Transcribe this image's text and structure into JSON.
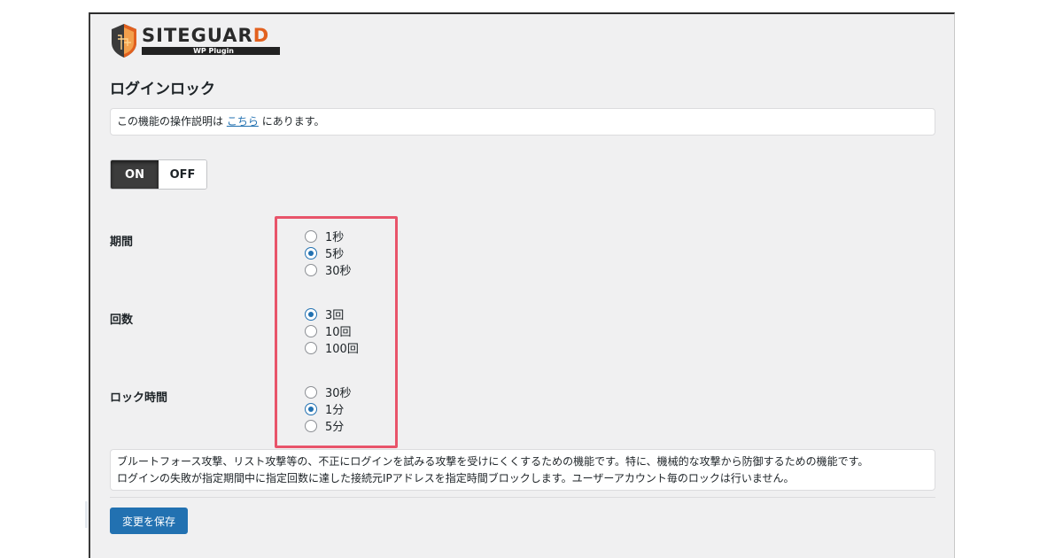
{
  "logo": {
    "wordmark_main": "SITEGUAR",
    "wordmark_accent": "D",
    "subtitle": "WP Plugin"
  },
  "page": {
    "title": "ログインロック",
    "notice_prefix": "この機能の操作説明は",
    "notice_link": "こちら",
    "notice_suffix": "にあります。"
  },
  "toggle": {
    "on_label": "ON",
    "off_label": "OFF",
    "selected": "ON"
  },
  "fields": {
    "period": {
      "label": "期間",
      "options": [
        "1秒",
        "5秒",
        "30秒"
      ],
      "selected": "5秒"
    },
    "count": {
      "label": "回数",
      "options": [
        "3回",
        "10回",
        "100回"
      ],
      "selected": "3回"
    },
    "lock_time": {
      "label": "ロック時間",
      "options": [
        "30秒",
        "1分",
        "5分"
      ],
      "selected": "1分"
    }
  },
  "description": {
    "line1": "ブルートフォース攻撃、リスト攻撃等の、不正にログインを試みる攻撃を受けにくくするための機能です。特に、機械的な攻撃から防御するための機能です。",
    "line2": "ログインの失敗が指定期間中に指定回数に達した接続元IPアドレスを指定時間ブロックします。ユーザーアカウント毎のロックは行いません。"
  },
  "save_button": "変更を保存",
  "colors": {
    "accent_blue": "#2271b1",
    "highlight_red": "#e8546a",
    "logo_orange": "#e2611f",
    "toggle_on_bg": "#3c3c3c"
  }
}
